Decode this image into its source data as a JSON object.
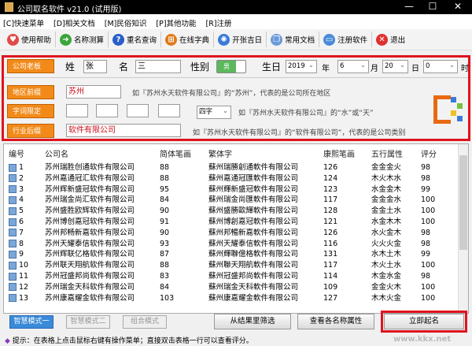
{
  "window": {
    "title": "公司取名软件 v21.0 (试用版)",
    "min": "—",
    "max": "☐",
    "close": "✕"
  },
  "menu": [
    "[C]快速菜单",
    "[D]相关文档",
    "[M]民俗知识",
    "[P]其他功能",
    "[R]注册"
  ],
  "toolbar": [
    {
      "label": "使用帮助",
      "icon": "heart-icon",
      "color": "#e04a4a",
      "glyph": "♥"
    },
    {
      "label": "名称测算",
      "icon": "arrow-right-icon",
      "color": "#3aa63a",
      "glyph": "➜"
    },
    {
      "label": "重名查询",
      "icon": "question-icon",
      "color": "#2a5ec8",
      "glyph": "?"
    },
    {
      "label": "在线字典",
      "icon": "windows-flag-icon",
      "color": "#e07a1a",
      "glyph": "⊞"
    },
    {
      "label": "开张吉日",
      "icon": "globe-icon",
      "color": "#3a7ad8",
      "glyph": "✺"
    },
    {
      "label": "常用文档",
      "icon": "documents-icon",
      "color": "#6a9ad8",
      "glyph": "❐"
    },
    {
      "label": "注册软件",
      "icon": "monitor-icon",
      "color": "#4a8ad8",
      "glyph": "▭"
    },
    {
      "label": "退出",
      "icon": "close-x-icon",
      "color": "#e03030",
      "glyph": "✕"
    }
  ],
  "form": {
    "boss_label": "公司老板",
    "surname_label": "姓",
    "surname": "张",
    "name_label": "名",
    "name": "三",
    "gender_label": "性别",
    "gender": "男",
    "birth_label": "生日",
    "year": "2019",
    "year_unit": "年",
    "month": "6",
    "month_unit": "月",
    "day": "20",
    "day_unit": "日",
    "hour": "0",
    "hour_unit": "时",
    "region_label": "地区前缀",
    "region": "苏州",
    "region_hint": "如『苏州水天软件有限公司』的“苏州”，代表的是公司所在地区",
    "word_label": "字词限定",
    "word_count": "四字",
    "word_hint": "如『苏州水天软件有限公司』的“水”或“天”",
    "industry_label": "行业后缀",
    "industry": "软件有限公司",
    "industry_hint": "如『苏州水天软件有限公司』的“软件有限公司”，代表的是公司类别"
  },
  "table": {
    "headers": [
      "编号",
      "公司名",
      "简体笔画",
      "繁体字",
      "康熙笔画",
      "五行属性",
      "评分"
    ],
    "rows": [
      [
        "1",
        "苏州瑞胜创通软件有限公司",
        "88",
        "蘇州瑞勝創通軟件有限公司",
        "126",
        "金金金火",
        "98"
      ],
      [
        "2",
        "苏州嘉通冠汇软件有限公司",
        "88",
        "蘇州嘉通冠匯軟件有限公司",
        "124",
        "木火木水",
        "98"
      ],
      [
        "3",
        "苏州辉新盛冠软件有限公司",
        "95",
        "蘇州輝新盛冠軟件有限公司",
        "123",
        "水金金木",
        "99"
      ],
      [
        "4",
        "苏州瑞金尚汇软件有限公司",
        "84",
        "蘇州瑞金尚匯軟件有限公司",
        "117",
        "金金金水",
        "100"
      ],
      [
        "5",
        "苏州盛胜欧辉软件有限公司",
        "90",
        "蘇州盛勝歐輝軟件有限公司",
        "128",
        "金金土水",
        "100"
      ],
      [
        "6",
        "苏州博创嘉冠软件有限公司",
        "91",
        "蘇州博創嘉冠軟件有限公司",
        "121",
        "水金木木",
        "100"
      ],
      [
        "7",
        "苏州邦畅新嘉软件有限公司",
        "90",
        "蘇州邦暢新嘉軟件有限公司",
        "126",
        "水火金木",
        "98"
      ],
      [
        "8",
        "苏州天耀泰信软件有限公司",
        "93",
        "蘇州天耀泰信軟件有限公司",
        "116",
        "火火火金",
        "98"
      ],
      [
        "9",
        "苏州辉联亿格软件有限公司",
        "87",
        "蘇州輝聯億格軟件有限公司",
        "131",
        "水木土木",
        "99"
      ],
      [
        "10",
        "苏州联天翔航软件有限公司",
        "88",
        "蘇州聯天翔航軟件有限公司",
        "117",
        "木火土水",
        "100"
      ],
      [
        "11",
        "苏州冠盛邦尚软件有限公司",
        "83",
        "蘇州冠盛邦尚軟件有限公司",
        "114",
        "木金水金",
        "98"
      ],
      [
        "12",
        "苏州瑞金天科软件有限公司",
        "84",
        "蘇州瑞金天科軟件有限公司",
        "109",
        "金金火木",
        "100"
      ],
      [
        "13",
        "苏州康嘉耀金软件有限公司",
        "103",
        "蘇州康嘉耀金軟件有限公司",
        "127",
        "木木火金",
        "100"
      ]
    ]
  },
  "bottom": {
    "mode1": "智慧模式一",
    "mode2": "智慧模式二",
    "mode3": "组合模式",
    "filter": "从结果里筛选",
    "view_attrs": "查看各名称属性",
    "start": "立即起名"
  },
  "status": {
    "text": "提示：在表格上点击鼠标右键有操作菜单；直接双击表格一行可以查看评分。"
  },
  "watermark": "www.kkx.net"
}
